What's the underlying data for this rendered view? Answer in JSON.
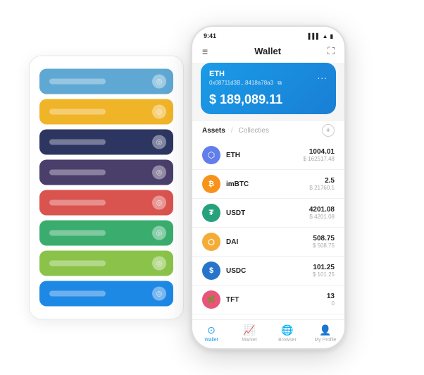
{
  "app": {
    "title": "Wallet"
  },
  "statusBar": {
    "time": "9:41",
    "signal": "▌▌▌",
    "wifi": "WiFi",
    "battery": "■"
  },
  "header": {
    "menuIcon": "≡",
    "title": "Wallet",
    "expandIcon": "⛶"
  },
  "ethCard": {
    "symbol": "ETH",
    "address": "0x08711d3B...8418a78a3",
    "addressSuffix": "☰",
    "balance": "$ 189,089.11",
    "dotsMenu": "..."
  },
  "assetsTabs": {
    "active": "Assets",
    "separator": "/",
    "inactive": "Collecties",
    "addIcon": "+"
  },
  "assets": [
    {
      "symbol": "ETH",
      "iconColor": "#627eea",
      "iconText": "⬡",
      "amount": "1004.01",
      "usd": "$ 162517.48"
    },
    {
      "symbol": "imBTC",
      "iconColor": "#f7931a",
      "iconText": "₿",
      "amount": "2.5",
      "usd": "$ 21760.1"
    },
    {
      "symbol": "USDT",
      "iconColor": "#26a17b",
      "iconText": "₮",
      "amount": "4201.08",
      "usd": "$ 4201.08"
    },
    {
      "symbol": "DAI",
      "iconColor": "#f5ac37",
      "iconText": "◈",
      "amount": "508.75",
      "usd": "$ 508.75"
    },
    {
      "symbol": "USDC",
      "iconColor": "#2775ca",
      "iconText": "⊙",
      "amount": "101.25",
      "usd": "$ 101.25"
    },
    {
      "symbol": "TFT",
      "iconColor": "#e8547a",
      "iconText": "🌿",
      "amount": "13",
      "usd": "0"
    }
  ],
  "bottomNav": [
    {
      "label": "Wallet",
      "icon": "⊙",
      "active": true
    },
    {
      "label": "Market",
      "icon": "📈",
      "active": false
    },
    {
      "label": "Browser",
      "icon": "🌐",
      "active": false
    },
    {
      "label": "My Profile",
      "icon": "👤",
      "active": false
    }
  ],
  "cardStack": [
    {
      "color": "#5fa8d3",
      "lineColor": "rgba(255,255,255,0.35)"
    },
    {
      "color": "#f0b429",
      "lineColor": "rgba(255,255,255,0.35)"
    },
    {
      "color": "#2d3561",
      "lineColor": "rgba(255,255,255,0.35)"
    },
    {
      "color": "#4a3f6b",
      "lineColor": "rgba(255,255,255,0.35)"
    },
    {
      "color": "#d9534f",
      "lineColor": "rgba(255,255,255,0.35)"
    },
    {
      "color": "#3aad6e",
      "lineColor": "rgba(255,255,255,0.35)"
    },
    {
      "color": "#8bc34a",
      "lineColor": "rgba(255,255,255,0.35)"
    },
    {
      "color": "#1e88e5",
      "lineColor": "rgba(255,255,255,0.35)"
    }
  ]
}
